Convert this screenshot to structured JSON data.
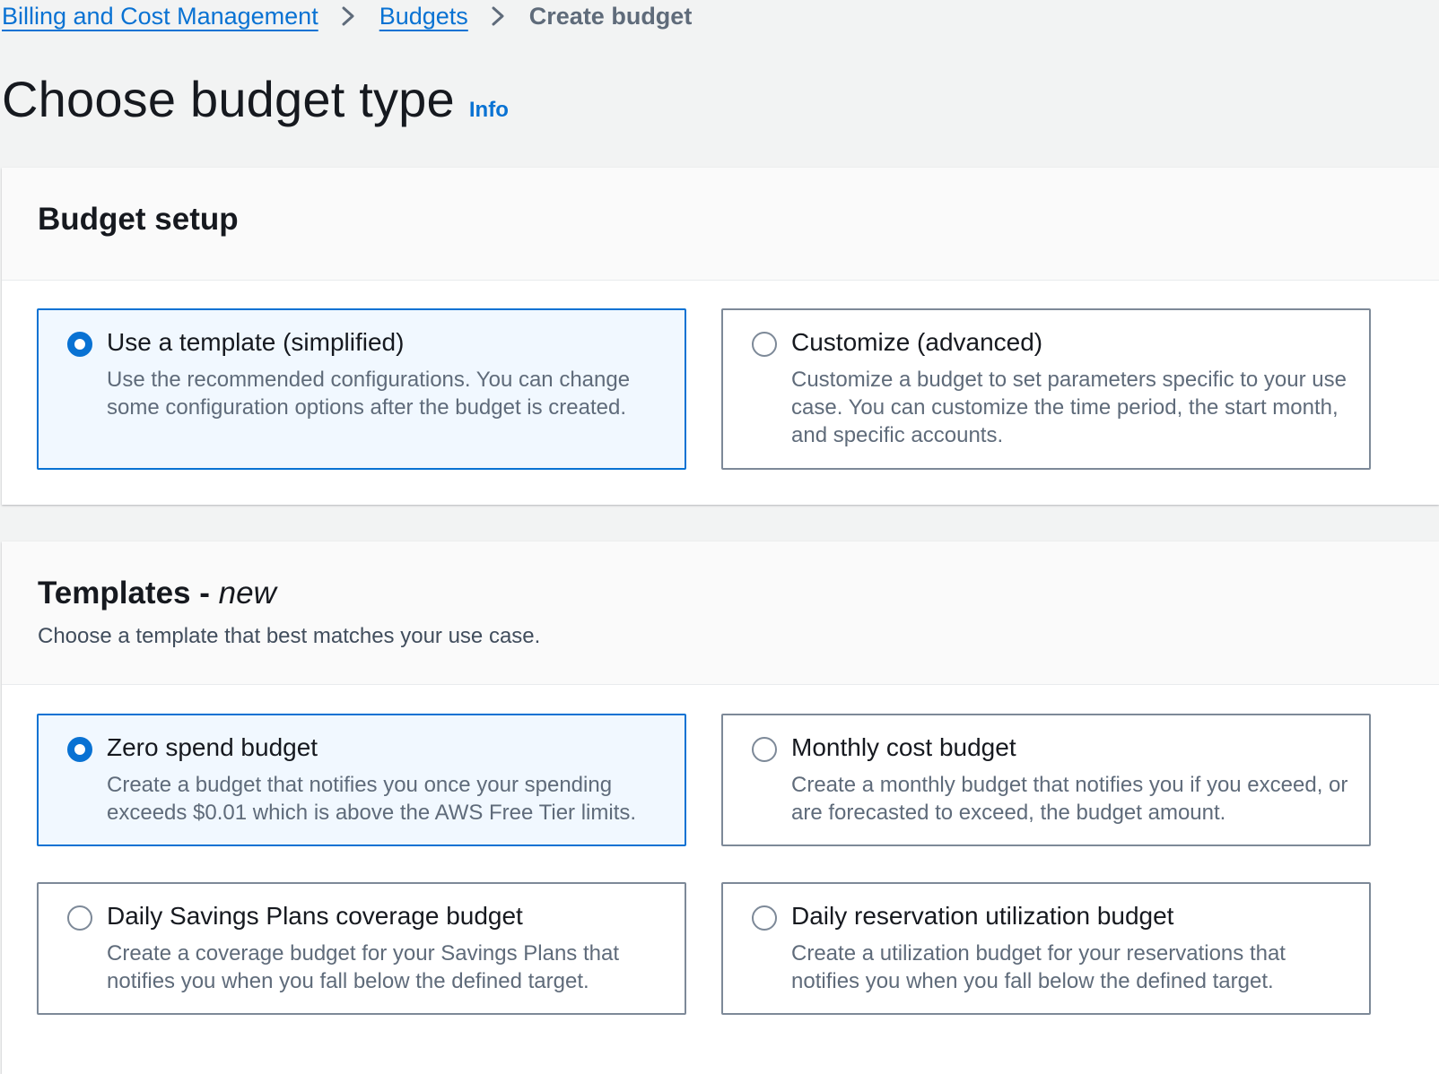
{
  "breadcrumb": {
    "items": [
      "Billing and Cost Management",
      "Budgets"
    ],
    "current": "Create budget"
  },
  "page": {
    "title": "Choose budget type",
    "info_label": "Info"
  },
  "budget_setup": {
    "title": "Budget setup",
    "options": [
      {
        "label": "Use a template (simplified)",
        "description": "Use the recommended configurations. You can change some configuration options after the budget is created.",
        "selected": true
      },
      {
        "label": "Customize (advanced)",
        "description": "Customize a budget to set parameters specific to your use case. You can customize the time period, the start month, and specific accounts.",
        "selected": false
      }
    ]
  },
  "templates": {
    "title": "Templates -",
    "title_tag": "new",
    "description": "Choose a template that best matches your use case.",
    "options": [
      {
        "label": "Zero spend budget",
        "description": "Create a budget that notifies you once your spending exceeds $0.01 which is above the AWS Free Tier limits.",
        "selected": true
      },
      {
        "label": "Monthly cost budget",
        "description": "Create a monthly budget that notifies you if you exceed, or are forecasted to exceed, the budget amount.",
        "selected": false
      },
      {
        "label": "Daily Savings Plans coverage budget",
        "description": "Create a coverage budget for your Savings Plans that notifies you when you fall below the defined target.",
        "selected": false
      },
      {
        "label": "Daily reservation utilization budget",
        "description": "Create a utilization budget for your reservations that notifies you when you fall below the defined target.",
        "selected": false
      }
    ]
  },
  "colors": {
    "link": "#0972d3",
    "selected_border": "#0972d3",
    "selected_background": "#f1f8ff",
    "page_background": "#f2f3f3"
  },
  "icons": {
    "breadcrumb_separator": "chevron-right-icon"
  }
}
